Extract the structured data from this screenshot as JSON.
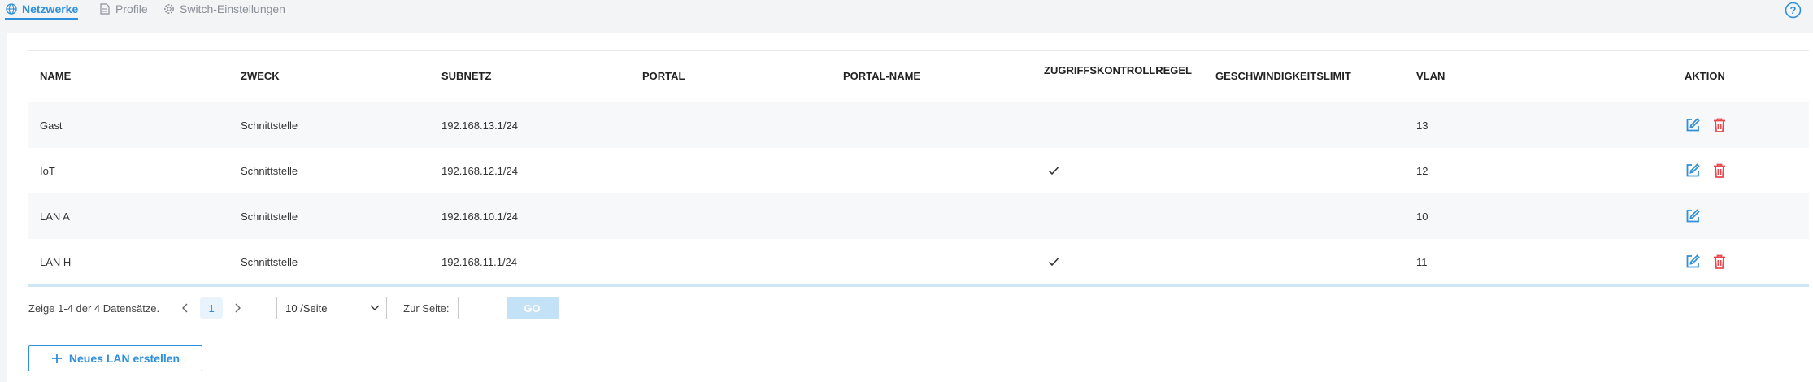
{
  "tabs": [
    {
      "label": "Netzwerke",
      "icon": "globe-icon",
      "active": true
    },
    {
      "label": "Profile",
      "icon": "document-icon",
      "active": false
    },
    {
      "label": "Switch-Einstellungen",
      "icon": "gear-icon",
      "active": false
    }
  ],
  "table": {
    "headers": {
      "name": "NAME",
      "zweck": "ZWECK",
      "subnetz": "SUBNETZ",
      "portal": "PORTAL",
      "portal_name": "PORTAL-NAME",
      "zugriff": "ZUGRIFFSKONTROLLREGEL",
      "geschwindigkeit": "GESCHWINDIGKEITSLIMIT",
      "vlan": "VLAN",
      "aktion": "AKTION"
    },
    "rows": [
      {
        "name": "Gast",
        "zweck": "Schnittstelle",
        "subnetz": "192.168.13.1/24",
        "portal": "",
        "portal_name": "",
        "zugriff": false,
        "geschwindigkeit": "",
        "vlan": "13",
        "deletable": true
      },
      {
        "name": "IoT",
        "zweck": "Schnittstelle",
        "subnetz": "192.168.12.1/24",
        "portal": "",
        "portal_name": "",
        "zugriff": true,
        "geschwindigkeit": "",
        "vlan": "12",
        "deletable": true
      },
      {
        "name": "LAN A",
        "zweck": "Schnittstelle",
        "subnetz": "192.168.10.1/24",
        "portal": "",
        "portal_name": "",
        "zugriff": false,
        "geschwindigkeit": "",
        "vlan": "10",
        "deletable": false
      },
      {
        "name": "LAN H",
        "zweck": "Schnittstelle",
        "subnetz": "192.168.11.1/24",
        "portal": "",
        "portal_name": "",
        "zugriff": true,
        "geschwindigkeit": "",
        "vlan": "11",
        "deletable": true
      }
    ]
  },
  "pagination": {
    "total_text": "Zeige 1-4 der 4 Datensätze.",
    "current_page": "1",
    "page_size": "10 /Seite",
    "goto_label": "Zur Seite:",
    "goto_value": "",
    "go_label": "GO"
  },
  "create_button": {
    "label": "Neues LAN erstellen",
    "icon": "plus-icon"
  },
  "colors": {
    "accent": "#2f8fd8",
    "delete": "#e5484d",
    "go_disabled": "#c4e2f7"
  }
}
